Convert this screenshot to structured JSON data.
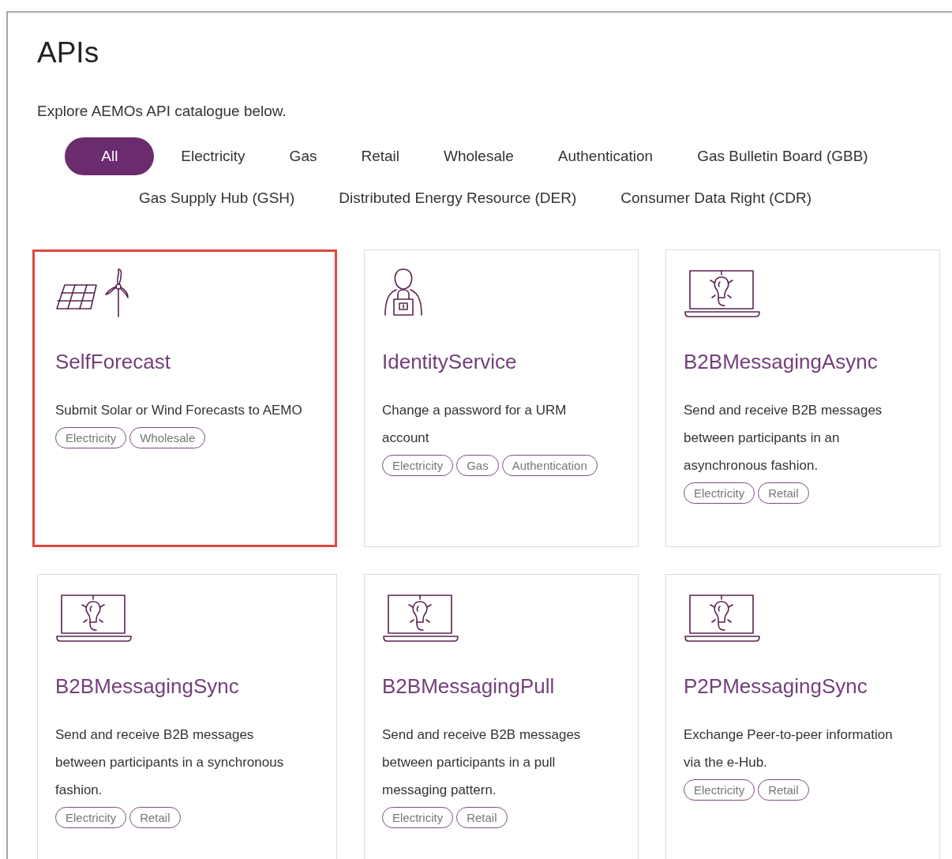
{
  "title": "APIs",
  "intro": "Explore AEMOs API catalogue below.",
  "filters": [
    {
      "label": "All",
      "selected": true
    },
    {
      "label": "Electricity",
      "selected": false
    },
    {
      "label": "Gas",
      "selected": false
    },
    {
      "label": "Retail",
      "selected": false
    },
    {
      "label": "Wholesale",
      "selected": false
    },
    {
      "label": "Authentication",
      "selected": false
    },
    {
      "label": "Gas Bulletin Board (GBB)",
      "selected": false
    },
    {
      "label": "Gas Supply Hub (GSH)",
      "selected": false
    },
    {
      "label": "Distributed Energy Resource (DER)",
      "selected": false
    },
    {
      "label": "Consumer Data Right (CDR)",
      "selected": false
    }
  ],
  "cards": [
    {
      "kind": "solar-wind",
      "title": "SelfForecast",
      "description": "Submit Solar or Wind Forecasts to AEMO",
      "tags": [
        "Electricity",
        "Wholesale"
      ],
      "selected": true
    },
    {
      "kind": "person-lock",
      "title": "IdentityService",
      "description": "Change a password for a URM account",
      "tags": [
        "Electricity",
        "Gas",
        "Authentication"
      ],
      "selected": false
    },
    {
      "kind": "laptop-bulb",
      "title": "B2BMessagingAsync",
      "description": "Send and receive B2B messages between participants in an asynchronous fashion.",
      "tags": [
        "Electricity",
        "Retail"
      ],
      "selected": false
    },
    {
      "kind": "laptop-bulb",
      "title": "B2BMessagingSync",
      "description": "Send and receive B2B messages between participants in a synchronous fashion.",
      "tags": [
        "Electricity",
        "Retail"
      ],
      "selected": false
    },
    {
      "kind": "laptop-bulb",
      "title": "B2BMessagingPull",
      "description": "Send and receive B2B messages between participants in a pull messaging pattern.",
      "tags": [
        "Electricity",
        "Retail"
      ],
      "selected": false
    },
    {
      "kind": "laptop-bulb",
      "title": "P2PMessagingSync",
      "description": "Exchange Peer-to-peer information via the e-Hub.",
      "tags": [
        "Electricity",
        "Retail"
      ],
      "selected": false
    }
  ]
}
